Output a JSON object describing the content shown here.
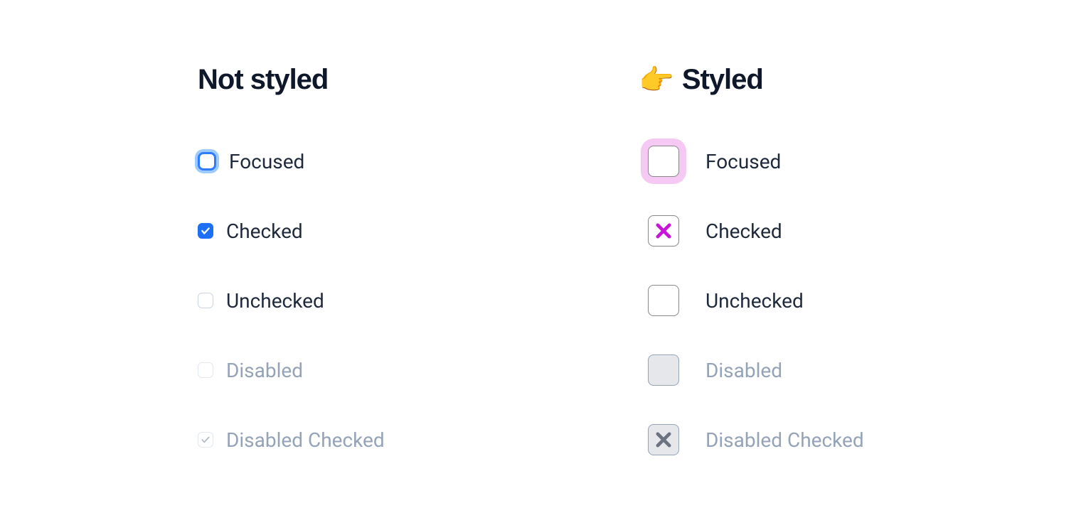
{
  "columns": {
    "not_styled": {
      "heading": "Not styled",
      "emoji": ""
    },
    "styled": {
      "heading": "Styled",
      "emoji": "👉"
    }
  },
  "states": {
    "focused": "Focused",
    "checked": "Checked",
    "unchecked": "Unchecked",
    "disabled": "Disabled",
    "disabled_checked": "Disabled Checked"
  },
  "colors": {
    "native_accent": "#1d6ff6",
    "native_focus_ring": "#93c5fd",
    "styled_check": "#c814d8",
    "styled_focus_ring": "#f5c9f3",
    "disabled_text": "#94a3b8",
    "disabled_bg": "#e5e7eb"
  }
}
